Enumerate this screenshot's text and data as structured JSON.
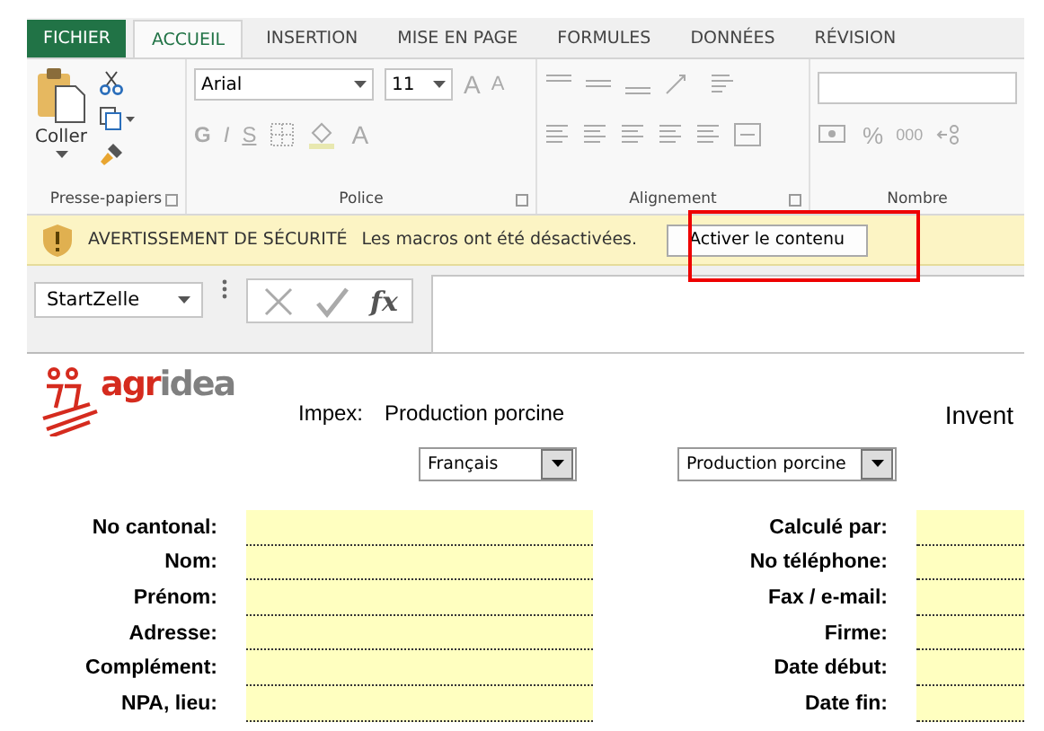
{
  "tabs": [
    {
      "label": "FICHIER",
      "kind": "file",
      "selected": false
    },
    {
      "label": "ACCUEIL",
      "kind": "tab",
      "selected": true
    },
    {
      "label": "INSERTION",
      "kind": "tab",
      "selected": false
    },
    {
      "label": "MISE EN PAGE",
      "kind": "tab",
      "selected": false
    },
    {
      "label": "FORMULES",
      "kind": "tab",
      "selected": false
    },
    {
      "label": "DONNÉES",
      "kind": "tab",
      "selected": false
    },
    {
      "label": "RÉVISION",
      "kind": "tab",
      "selected": false
    }
  ],
  "clipboard": {
    "paste_label": "Coller",
    "group_label": "Presse-papiers"
  },
  "font": {
    "name": "Arial",
    "size": "11",
    "grow": "A",
    "shrink": "A",
    "bold": "G",
    "italic": "I",
    "underline": "S",
    "color_letter": "A",
    "group_label": "Police"
  },
  "alignment": {
    "group_label": "Alignement"
  },
  "number": {
    "percent": "%",
    "thousands": "000",
    "group_label": "Nombre"
  },
  "security_bar": {
    "title": "AVERTISSEMENT DE SÉCURITÉ",
    "message": "Les macros ont été désactivées.",
    "button": "Activer le contenu"
  },
  "formula_bar": {
    "name_box": "StartZelle",
    "function_symbol": "fx"
  },
  "sheet": {
    "logo": {
      "first": "agr",
      "second": "idea"
    },
    "impex_label": "Impex:",
    "impex_value": "Production porcine",
    "heading": "Invent",
    "language_dropdown": "Français",
    "production_dropdown": "Production porcine",
    "left_fields": [
      "No cantonal:",
      "Nom:",
      "Prénom:",
      "Adresse:",
      "Complément:",
      "NPA, lieu:"
    ],
    "right_fields": [
      "Calculé par:",
      "No téléphone:",
      "Fax / e-mail:",
      "Firme:",
      "Date début:",
      "Date fin:"
    ]
  }
}
